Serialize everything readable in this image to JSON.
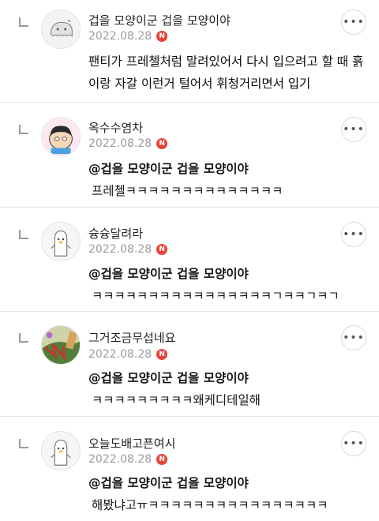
{
  "comments": [
    {
      "nickname": "겁을 모양이군 겁을 모양이야",
      "date": "2022.08.28",
      "badge": "N",
      "mention": "",
      "text": "팬티가 프레첼처럼 말려있어서 다시 입으려고 할 때 흙이랑 자갈 이런거 털어서 휘청거리면서 입기",
      "avatar_icon": "ghost-character-icon"
    },
    {
      "nickname": "옥수수염차",
      "date": "2022.08.28",
      "badge": "N",
      "mention": "@겁을 모양이군 겁을 모양이야",
      "text": "프레첼ㅋㅋㅋㅋㅋㅋㅋㅋㅋㅋㅋㅋㅋㅋ",
      "avatar_icon": "kakao-character-icon"
    },
    {
      "nickname": "슝슝달려라",
      "date": "2022.08.28",
      "badge": "N",
      "mention": "@겁을 모양이군 겁을 모양이야",
      "text": "ㅋㅋㅋㅋㅋㅋㅋㅋㅋㅋㅋㅋㅋㅋㅋㅋㄱㅋㅋㄱㅋㄱ",
      "avatar_icon": "penguin-character-icon"
    },
    {
      "nickname": "그거조금무섭네요",
      "date": "2022.08.28",
      "badge": "N",
      "mention": "@겁을 모양이군 겁을 모양이야",
      "text": "ㅋㅋㅋㅋㅋㅋㅋㅋㅋ왜케디테일해",
      "avatar_icon": "photo-avatar-icon"
    },
    {
      "nickname": "오늘도배고픈여시",
      "date": "2022.08.28",
      "badge": "N",
      "mention": "@겁을 모양이군 겁을 모양이야",
      "text": "해봤냐고ㅠㅋㅋㅋㅋㅋㅋㅋㅋㅋㅋㅋㅋㅋㅋㅋㅋ",
      "avatar_icon": "penguin-character-icon"
    }
  ],
  "more_label": "•••"
}
